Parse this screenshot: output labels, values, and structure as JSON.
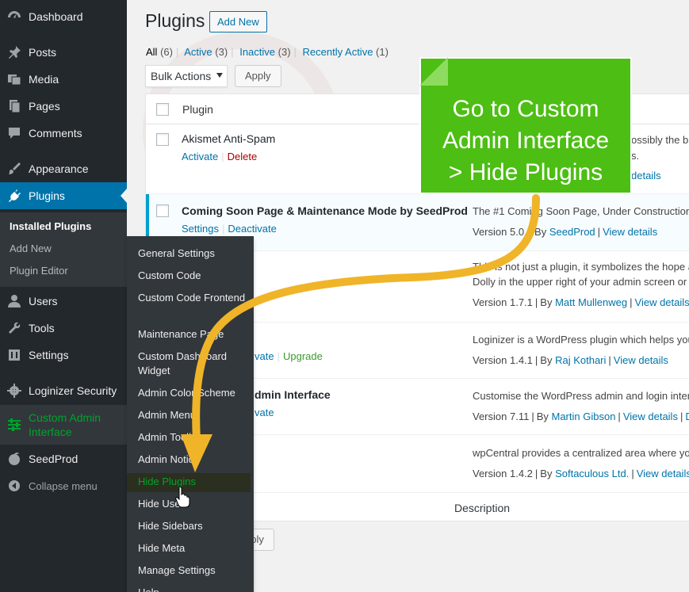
{
  "sidebar": {
    "items": [
      {
        "label": "Dashboard",
        "icon": "dashboard-icon"
      },
      {
        "label": "Posts",
        "icon": "pin-icon"
      },
      {
        "label": "Media",
        "icon": "media-icon"
      },
      {
        "label": "Pages",
        "icon": "pages-icon"
      },
      {
        "label": "Comments",
        "icon": "comment-icon"
      },
      {
        "label": "Appearance",
        "icon": "brush-icon"
      },
      {
        "label": "Plugins",
        "icon": "plug-icon"
      },
      {
        "label": "Users",
        "icon": "user-icon"
      },
      {
        "label": "Tools",
        "icon": "wrench-icon"
      },
      {
        "label": "Settings",
        "icon": "settings-icon"
      },
      {
        "label": "Loginizer Security",
        "icon": "gear-icon"
      },
      {
        "label": "Custom Admin Interface",
        "icon": "sliders-icon"
      },
      {
        "label": "SeedProd",
        "icon": "seed-icon"
      },
      {
        "label": "Collapse menu",
        "icon": "collapse-icon"
      }
    ],
    "submenu": [
      "Installed Plugins",
      "Add New",
      "Plugin Editor"
    ]
  },
  "flyout": {
    "items": [
      "General Settings",
      "Custom Code",
      "Custom Code Frontend",
      "Maintenance Page",
      "Custom Dashboard Widget",
      "Admin Color Scheme",
      "Admin Menu",
      "Admin Toolbar",
      "Admin Notice",
      "Hide Plugins",
      "Hide Users",
      "Hide Sidebars",
      "Hide Meta",
      "Manage Settings",
      "Help"
    ]
  },
  "header": {
    "title": "Plugins",
    "add_new": "Add New"
  },
  "filters": {
    "all": "All",
    "all_count": "(6)",
    "active": "Active",
    "active_count": "(3)",
    "inactive": "Inactive",
    "inactive_count": "(3)",
    "recent": "Recently Active",
    "recent_count": "(1)"
  },
  "bulk": {
    "select": "Bulk Actions",
    "apply": "Apply"
  },
  "table": {
    "col_plugin": "Plugin",
    "col_description": "Description",
    "rows": [
      {
        "name": "Akismet Anti-Spam",
        "a1": "Activate",
        "a2": "Delete",
        "desc1": "ossibly the b",
        "desc2": "s.",
        "ver_link": "details"
      },
      {
        "name": "Coming Soon Page & Maintenance Mode by SeedProd",
        "a1": "Settings",
        "a2": "Deactivate",
        "desc1": "The #1 Coming Soon Page, Under Construction",
        "version": "Version 5.0.",
        "by": "By",
        "author": "SeedProd",
        "details": "View details"
      },
      {
        "desc1": "This is not just a plugin, it symbolizes the hope a",
        "desc2": "Dolly in the upper right of your admin screen or",
        "version": "Version 1.7.1",
        "by": "By",
        "author": "Matt Mullenweg",
        "details": "View details"
      },
      {
        "a1": "vate",
        "a2": "Upgrade",
        "desc1": "Loginizer is a WordPress plugin which helps you",
        "version": "Version 1.4.1",
        "by": "By",
        "author": "Raj Kothari",
        "details": "View details"
      },
      {
        "name": "dmin Interface",
        "a1": "vate",
        "desc1": "Customise the WordPress admin and login inter",
        "version": "Version 7.11",
        "by": "By",
        "author": "Martin Gibson",
        "details": "View details",
        "extra": "D"
      },
      {
        "desc1": "wpCentral provides a centralized area where you",
        "version": "Version 1.4.2",
        "by": "By",
        "author": "Softaculous Ltd.",
        "details": "View details"
      }
    ]
  },
  "callout": {
    "line1": "Go to Custom",
    "line2": "Admin Interface",
    "line3": "> Hide Plugins"
  },
  "bottom_apply": "pply",
  "colors": {
    "sidebar_bg": "#23282d",
    "accent_blue": "#0073aa",
    "callout_green": "#4dbe14",
    "arrow_yellow": "#f0b429",
    "active_green": "#00a32a"
  }
}
